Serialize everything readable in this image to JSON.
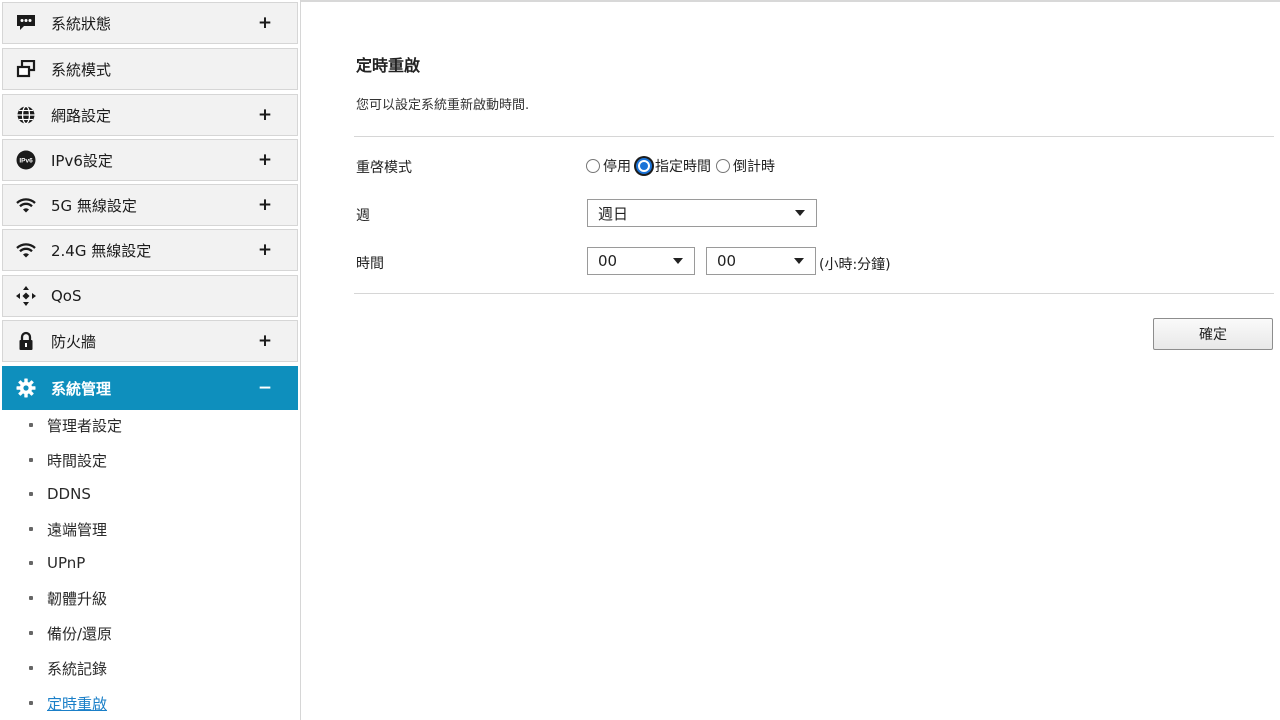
{
  "sidebar": {
    "menu": [
      {
        "label": "系統狀態",
        "toggle": "+",
        "icon": "chat-bubble-icon"
      },
      {
        "label": "系統模式",
        "toggle": "",
        "icon": "windows-icon"
      },
      {
        "label": "網路設定",
        "toggle": "+",
        "icon": "globe-icon"
      },
      {
        "label": "IPv6設定",
        "toggle": "+",
        "icon": "ipv6-icon",
        "icon_text": "IPv6"
      },
      {
        "label": "5G 無線設定",
        "toggle": "+",
        "icon": "wifi-icon"
      },
      {
        "label": "2.4G 無線設定",
        "toggle": "+",
        "icon": "wifi-icon"
      },
      {
        "label": "QoS",
        "toggle": "",
        "icon": "qos-arrows-icon"
      },
      {
        "label": "防火牆",
        "toggle": "+",
        "icon": "lock-icon"
      },
      {
        "label": "系統管理",
        "toggle": "−",
        "icon": "gear-icon",
        "active": true
      }
    ],
    "submenu": [
      {
        "label": "管理者設定"
      },
      {
        "label": "時間設定"
      },
      {
        "label": "DDNS"
      },
      {
        "label": "遠端管理"
      },
      {
        "label": "UPnP"
      },
      {
        "label": "韌體升級"
      },
      {
        "label": "備份/還原"
      },
      {
        "label": "系統記錄"
      },
      {
        "label": "定時重啟",
        "current": true
      }
    ]
  },
  "main": {
    "title": "定時重啟",
    "description": "您可以設定系統重新啟動時間.",
    "mode": {
      "label": "重啓模式",
      "options": [
        {
          "label": "停用",
          "checked": false
        },
        {
          "label": "指定時間",
          "checked": true
        },
        {
          "label": "倒計時",
          "checked": false
        }
      ]
    },
    "week": {
      "label": "週",
      "value": "週日"
    },
    "time": {
      "label": "時間",
      "hour": "00",
      "minute": "00",
      "separator": ":",
      "unit": "(小時:分鐘)"
    },
    "confirm_label": "確定"
  },
  "colors": {
    "accent": "#0e8fbd",
    "link": "#1a7fc8",
    "radio_selected": "#1a73d8"
  }
}
